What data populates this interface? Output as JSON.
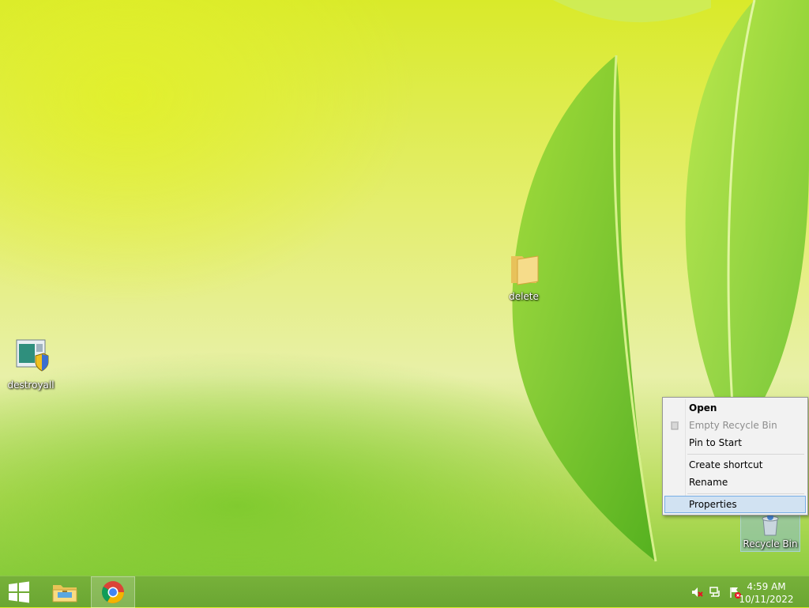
{
  "desktop": {
    "icons": [
      {
        "label": "destroyall",
        "icon": "installer-shield-icon"
      },
      {
        "label": "delete",
        "icon": "folder-icon"
      },
      {
        "label": "Recycle Bin",
        "icon": "recycle-bin-icon"
      }
    ]
  },
  "context_menu": {
    "items": [
      {
        "label": "Open",
        "style": "bold"
      },
      {
        "label": "Empty Recycle Bin",
        "style": "disabled"
      },
      {
        "label": "Pin to Start",
        "style": "normal"
      },
      {
        "label": "Create shortcut",
        "style": "normal"
      },
      {
        "label": "Rename",
        "style": "normal"
      },
      {
        "label": "Properties",
        "style": "hover"
      }
    ]
  },
  "taskbar": {
    "buttons": [
      "start-button",
      "file-explorer",
      "google-chrome"
    ],
    "active": "google-chrome",
    "tray": [
      "volume-muted-icon",
      "network-icon",
      "action-center-flag-icon"
    ],
    "clock": {
      "time": "4:59 AM",
      "date": "10/11/2022"
    }
  },
  "colors": {
    "taskbar": "#6ea934",
    "menu_hover": "#d1e2f2",
    "menu_hover_border": "#78aee5"
  }
}
